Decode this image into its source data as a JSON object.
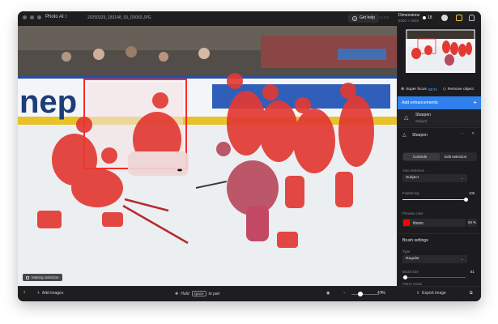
{
  "titlebar": {
    "app_name": "Photo AI",
    "app_badge": "3",
    "file_name": "20250329_183148_93_D0060.JPG",
    "help_label": "Get help",
    "version": "v4.0.0",
    "dimensions_title": "Dimensions",
    "dimensions_value": "5300 × 3533",
    "credits": "18"
  },
  "canvas": {
    "status_chip": "Making selection"
  },
  "bottombar": {
    "add_images": "Add images",
    "hint_prefix": "Hold",
    "hint_key": "space",
    "hint_suffix": "to pan",
    "zoom": "47%",
    "export_label": "Export image"
  },
  "panel": {
    "super_focus": "Super focus",
    "beta": "BETA",
    "remove_object": "Remove object",
    "add_enhancements": "Add enhancements",
    "enh_item_title": "Sharpen",
    "enh_item_sub": "Subject",
    "section_title": "Sharpen",
    "tab_controls": "Controls",
    "tab_edit": "Edit selection",
    "auto_selection_label": "Auto selection",
    "auto_selection_value": "Subject",
    "feathering_label": "Feathering",
    "feathering_value": "100",
    "preview_color_label": "Preview color",
    "preview_color_hex": "ff0000",
    "preview_opacity": "50 %",
    "brush_settings": "Brush settings",
    "type_label": "Type",
    "type_value": "Regular",
    "brush_size_label": "Brush size",
    "brush_size_value": "81",
    "paint_erase_label": "Paint / erase"
  },
  "colors": {
    "accent": "#2f80ed",
    "mask": "#ff0000"
  }
}
